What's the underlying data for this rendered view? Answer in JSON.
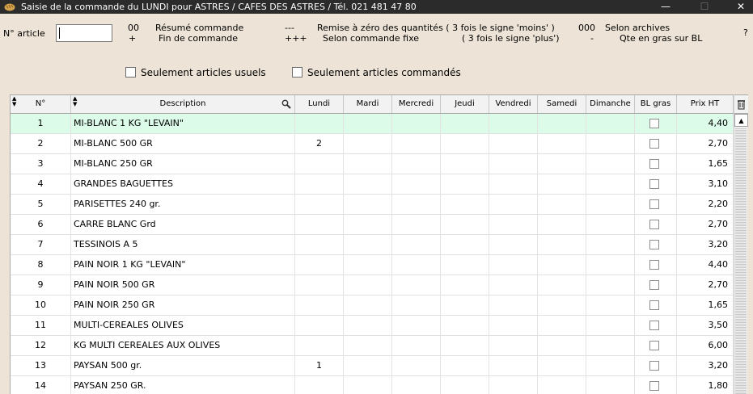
{
  "window": {
    "title": "Saisie de la commande du LUNDI pour ASTRES / CAFES DES ASTRES / Tél. 021 481 47 80",
    "minimize": "—",
    "maximize": "☐",
    "close": "✕"
  },
  "form": {
    "article_label": "N° article",
    "article_value": ""
  },
  "shortcuts": [
    {
      "key": "00",
      "label": "Résumé commande"
    },
    {
      "key": "+",
      "label": "Fin de commande"
    },
    {
      "key": "---",
      "label": "Remise à zéro des quantités ( 3 fois le signe 'moins' )"
    },
    {
      "key": "+++",
      "label": "Selon commande fixe"
    },
    {
      "key": "000",
      "label": "Selon archives"
    },
    {
      "key": "-",
      "label": "Qte en gras sur BL"
    }
  ],
  "plus_hint": "( 3 fois le signe 'plus')",
  "help": "?",
  "filters": {
    "usual_label": "Seulement articles usuels",
    "ordered_label": "Seulement articles commandés"
  },
  "grid": {
    "columns": {
      "no": "N°",
      "desc": "Description",
      "lundi": "Lundi",
      "mardi": "Mardi",
      "mercredi": "Mercredi",
      "jeudi": "Jeudi",
      "vendredi": "Vendredi",
      "samedi": "Samedi",
      "dimanche": "Dimanche",
      "bl": "BL gras",
      "prix": "Prix HT"
    },
    "rows": [
      {
        "no": "1",
        "desc": "MI-BLANC 1 KG \"LEVAIN\"",
        "lundi": "",
        "prix": "4,40",
        "selected": true
      },
      {
        "no": "2",
        "desc": "MI-BLANC 500 GR",
        "lundi": "2",
        "prix": "2,70"
      },
      {
        "no": "3",
        "desc": "MI-BLANC 250 GR",
        "lundi": "",
        "prix": "1,65"
      },
      {
        "no": "4",
        "desc": "GRANDES BAGUETTES",
        "lundi": "",
        "prix": "3,10"
      },
      {
        "no": "5",
        "desc": "PARISETTES 240 gr.",
        "lundi": "",
        "prix": "2,20"
      },
      {
        "no": "6",
        "desc": "CARRE BLANC Grd",
        "lundi": "",
        "prix": "2,70"
      },
      {
        "no": "7",
        "desc": "TESSINOIS A 5",
        "lundi": "",
        "prix": "3,20"
      },
      {
        "no": "8",
        "desc": "PAIN NOIR 1 KG \"LEVAIN\"",
        "lundi": "",
        "prix": "4,40"
      },
      {
        "no": "9",
        "desc": "PAIN NOIR 500 GR",
        "lundi": "",
        "prix": "2,70"
      },
      {
        "no": "10",
        "desc": "PAIN NOIR 250 GR",
        "lundi": "",
        "prix": "1,65"
      },
      {
        "no": "11",
        "desc": "MULTI-CEREALES OLIVES",
        "lundi": "",
        "prix": "3,50"
      },
      {
        "no": "12",
        "desc": "KG MULTI CEREALES AUX OLIVES",
        "lundi": "",
        "prix": "6,00"
      },
      {
        "no": "13",
        "desc": "PAYSAN 500 gr.",
        "lundi": "1",
        "prix": "3,20"
      },
      {
        "no": "14",
        "desc": "PAYSAN 250 GR.",
        "lundi": "",
        "prix": "1,80"
      }
    ]
  },
  "colors": {
    "selected_row": "#dcfbe9",
    "titlebar": "#2b2b2b",
    "panel": "#ede4d7"
  },
  "icons": {
    "app": "bread-icon",
    "column_search": "magnifier-icon",
    "column_menu": "column-chooser-icon"
  }
}
